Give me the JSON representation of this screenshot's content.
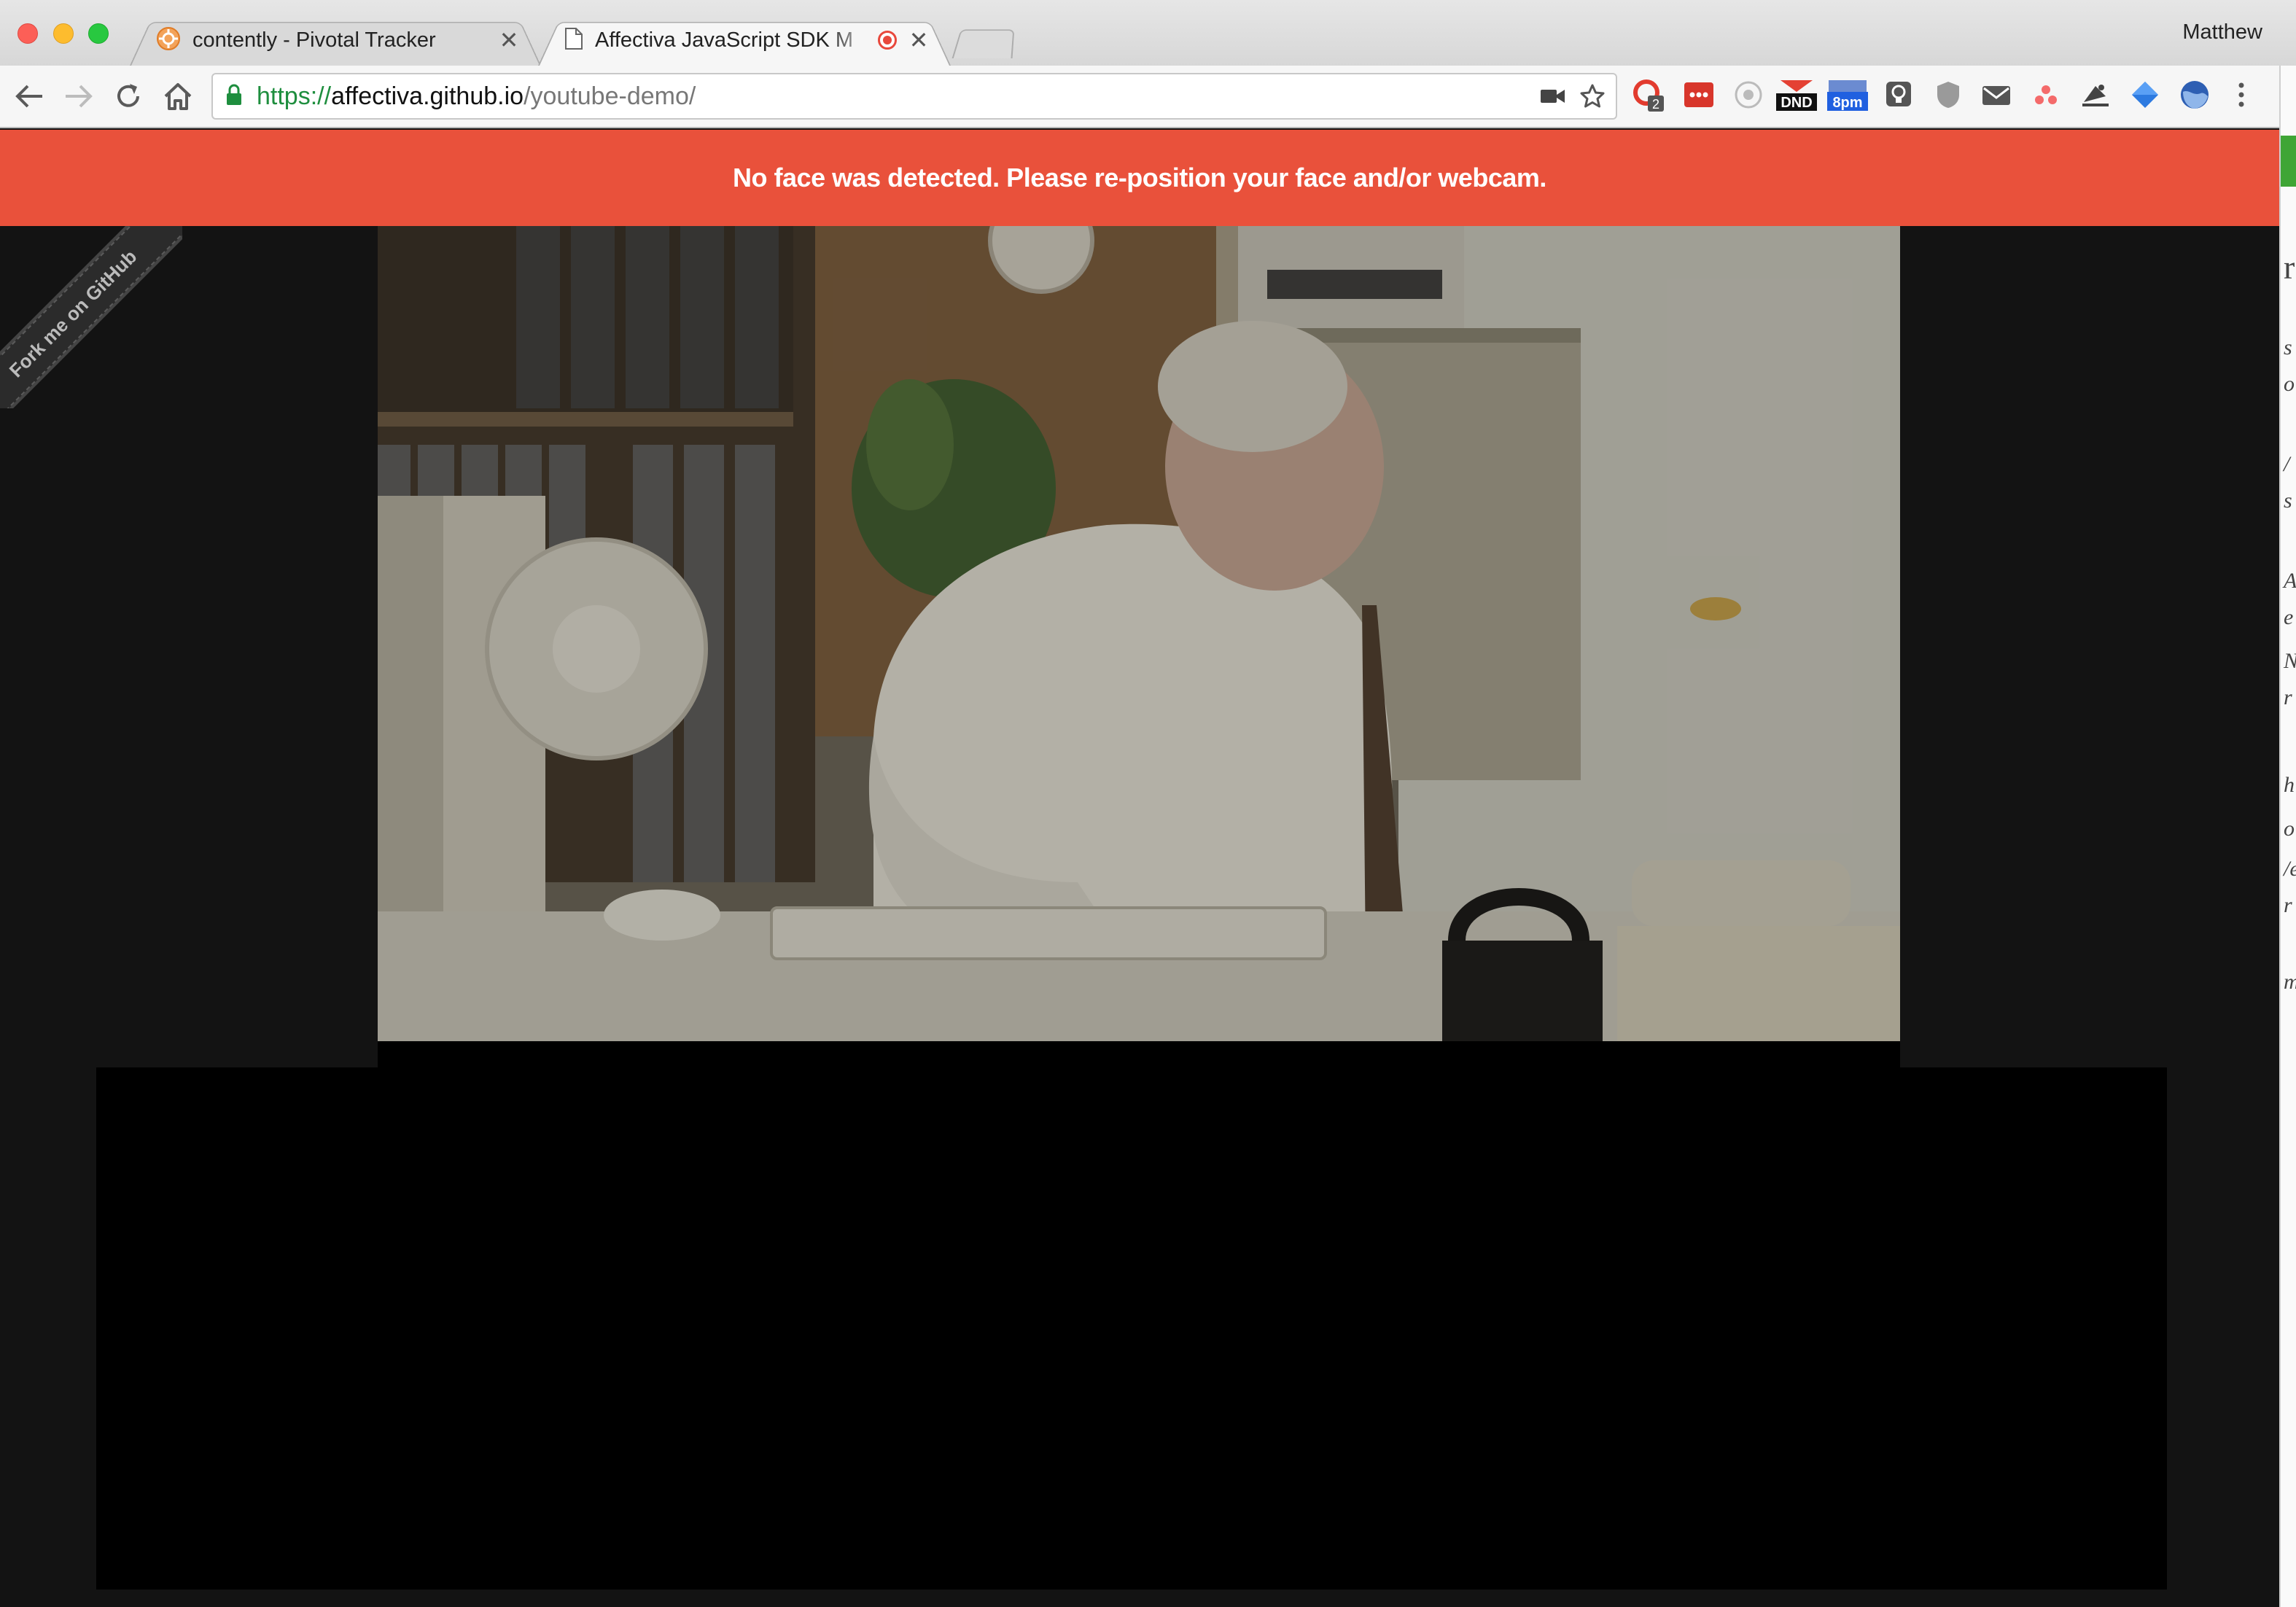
{
  "browser": {
    "tabs": [
      {
        "title": "contently - Pivotal Tracker",
        "active": false,
        "favicon": "pivotal-tracker-icon"
      },
      {
        "title": "Affectiva JavaScript SDK M",
        "active": true,
        "favicon": "document-icon",
        "recording": true
      }
    ],
    "profile_name": "Matthew",
    "url": {
      "scheme": "https://",
      "host": "affectiva.github.io",
      "path": "/youtube-demo/"
    },
    "extensions": [
      {
        "name": "ext-badge-icon",
        "badge": "2"
      },
      {
        "name": "ext-dots-icon"
      },
      {
        "name": "ext-circle-icon"
      },
      {
        "name": "ext-dnd-icon",
        "label": "DND"
      },
      {
        "name": "ext-calendar-icon",
        "label": "8pm"
      },
      {
        "name": "ext-bulb-icon"
      },
      {
        "name": "ext-shield-icon"
      },
      {
        "name": "ext-mail-icon"
      },
      {
        "name": "ext-asana-icon"
      },
      {
        "name": "ext-hat-icon"
      },
      {
        "name": "ext-diamond-icon"
      },
      {
        "name": "ext-globe-icon"
      }
    ]
  },
  "page": {
    "alert_message": "No face was detected. Please re-position your face and/or webcam.",
    "ribbon_text": "Fork me on GitHub",
    "alert_color": "#e9513b"
  },
  "right_sliver_glyphs": [
    "r",
    "s",
    "o",
    "/",
    "s",
    "A",
    "e",
    "N",
    "r",
    "h",
    "o",
    "/e",
    "r",
    "m"
  ]
}
